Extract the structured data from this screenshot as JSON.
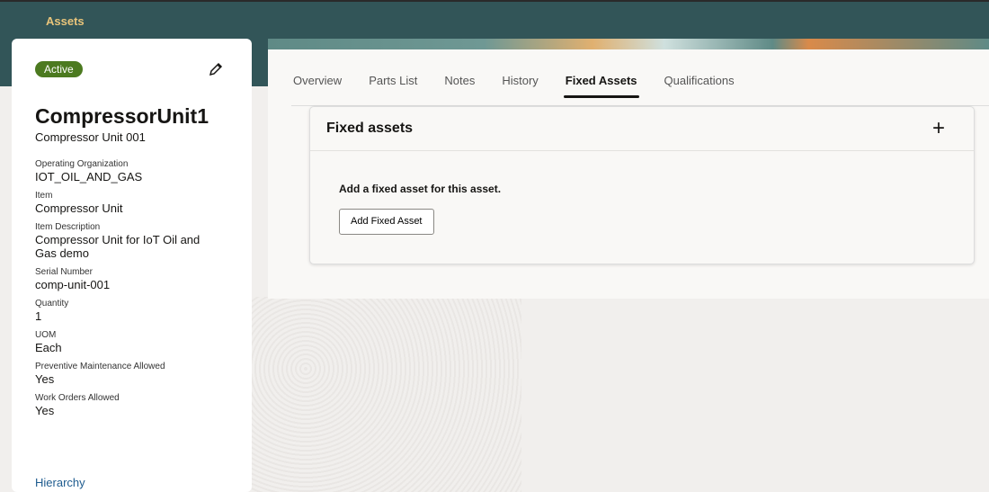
{
  "app": {
    "title": "Assets"
  },
  "asset": {
    "status": "Active",
    "name": "CompressorUnit1",
    "description": "Compressor Unit 001",
    "fields": [
      {
        "label": "Operating Organization",
        "value": "IOT_OIL_AND_GAS"
      },
      {
        "label": "Item",
        "value": "Compressor Unit"
      },
      {
        "label": "Item Description",
        "value": "Compressor Unit for IoT Oil and Gas demo"
      },
      {
        "label": "Serial Number",
        "value": "comp-unit-001"
      },
      {
        "label": "Quantity",
        "value": "1"
      },
      {
        "label": "UOM",
        "value": "Each"
      },
      {
        "label": "Preventive Maintenance Allowed",
        "value": "Yes"
      },
      {
        "label": "Work Orders Allowed",
        "value": "Yes"
      }
    ],
    "hierarchy_link": "Hierarchy"
  },
  "tabs": [
    {
      "label": "Overview"
    },
    {
      "label": "Parts List"
    },
    {
      "label": "Notes"
    },
    {
      "label": "History"
    },
    {
      "label": "Fixed Assets"
    },
    {
      "label": "Qualifications"
    }
  ],
  "panel": {
    "title": "Fixed assets",
    "message": "Add a fixed asset for this asset.",
    "button": "Add Fixed Asset",
    "add_icon": "plus-icon"
  }
}
